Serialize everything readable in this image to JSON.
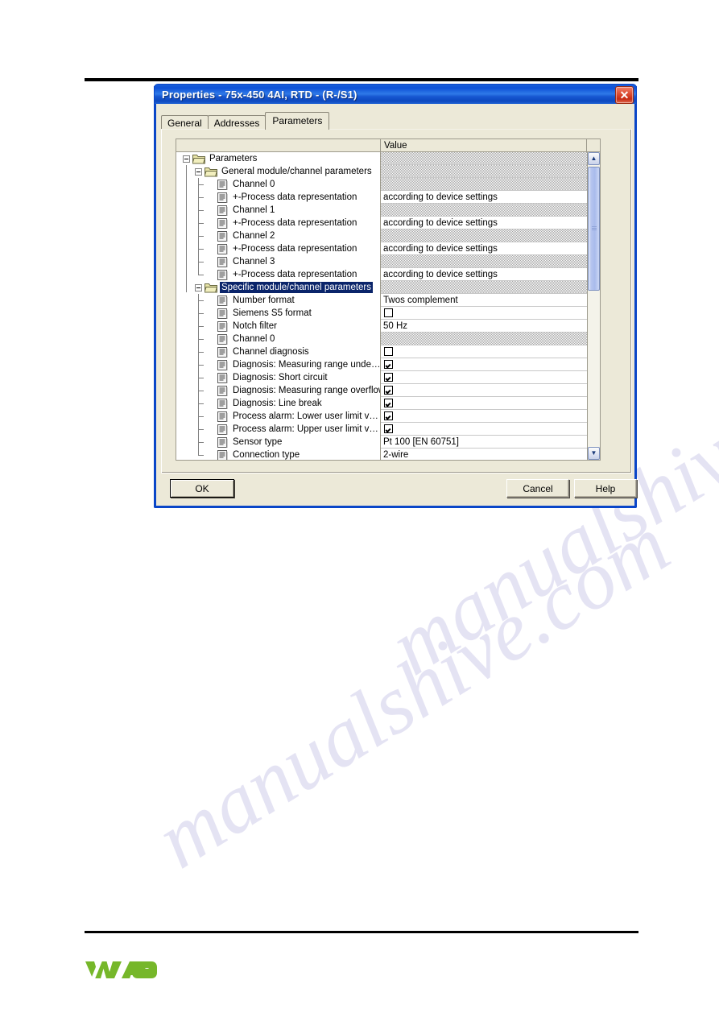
{
  "document": {
    "logo_text": "WAGO"
  },
  "dialog": {
    "title": "Properties - 75x-450 4AI, RTD - (R-/S1)",
    "close_label": "✕",
    "tabs": [
      {
        "label": "General",
        "active": false
      },
      {
        "label": "Addresses",
        "active": false
      },
      {
        "label": "Parameters",
        "active": true
      }
    ],
    "grid": {
      "headers": {
        "name": "",
        "value": "Value"
      },
      "rows": [
        {
          "label": "Parameters",
          "depth": 0,
          "icon": "folder-open-icon",
          "expander": "minus",
          "selected": false,
          "value_type": "disabled",
          "value": ""
        },
        {
          "label": "General module/channel parameters",
          "depth": 1,
          "icon": "folder-open-icon",
          "expander": "minus",
          "selected": false,
          "value_type": "disabled",
          "value": ""
        },
        {
          "label": "Channel 0",
          "depth": 2,
          "icon": "document-icon",
          "expander": "none",
          "selected": false,
          "value_type": "disabled",
          "value": ""
        },
        {
          "label": "+-Process data representation",
          "depth": 2,
          "icon": "document-icon",
          "expander": "none",
          "selected": false,
          "value_type": "text",
          "value": "according to device settings"
        },
        {
          "label": "Channel 1",
          "depth": 2,
          "icon": "document-icon",
          "expander": "none",
          "selected": false,
          "value_type": "disabled",
          "value": ""
        },
        {
          "label": "+-Process data representation",
          "depth": 2,
          "icon": "document-icon",
          "expander": "none",
          "selected": false,
          "value_type": "text",
          "value": "according to device settings"
        },
        {
          "label": "Channel 2",
          "depth": 2,
          "icon": "document-icon",
          "expander": "none",
          "selected": false,
          "value_type": "disabled",
          "value": ""
        },
        {
          "label": "+-Process data representation",
          "depth": 2,
          "icon": "document-icon",
          "expander": "none",
          "selected": false,
          "value_type": "text",
          "value": "according to device settings"
        },
        {
          "label": "Channel 3",
          "depth": 2,
          "icon": "document-icon",
          "expander": "none",
          "selected": false,
          "value_type": "disabled",
          "value": ""
        },
        {
          "label": "+-Process data representation",
          "depth": 2,
          "icon": "document-icon",
          "expander": "none",
          "selected": false,
          "value_type": "text",
          "value": "according to device settings"
        },
        {
          "label": "Specific module/channel parameters",
          "depth": 1,
          "icon": "folder-open-icon",
          "expander": "minus",
          "selected": true,
          "value_type": "disabled",
          "value": ""
        },
        {
          "label": "Number format",
          "depth": 2,
          "icon": "document-icon",
          "expander": "none",
          "selected": false,
          "value_type": "text",
          "value": "Twos complement"
        },
        {
          "label": "Siemens S5 format",
          "depth": 2,
          "icon": "document-icon",
          "expander": "none",
          "selected": false,
          "value_type": "checkbox",
          "value": false
        },
        {
          "label": "Notch filter",
          "depth": 2,
          "icon": "document-icon",
          "expander": "none",
          "selected": false,
          "value_type": "text",
          "value": "50 Hz"
        },
        {
          "label": "Channel 0",
          "depth": 2,
          "icon": "document-icon",
          "expander": "none",
          "selected": false,
          "value_type": "disabled",
          "value": ""
        },
        {
          "label": "Channel diagnosis",
          "depth": 2,
          "icon": "document-icon",
          "expander": "none",
          "selected": false,
          "value_type": "checkbox",
          "value": false
        },
        {
          "label": "Diagnosis: Measuring range unde…",
          "depth": 2,
          "icon": "document-icon",
          "expander": "none",
          "selected": false,
          "value_type": "checkbox",
          "value": true
        },
        {
          "label": "Diagnosis: Short circuit",
          "depth": 2,
          "icon": "document-icon",
          "expander": "none",
          "selected": false,
          "value_type": "checkbox",
          "value": true
        },
        {
          "label": "Diagnosis: Measuring range overflow",
          "depth": 2,
          "icon": "document-icon",
          "expander": "none",
          "selected": false,
          "value_type": "checkbox",
          "value": true
        },
        {
          "label": "Diagnosis: Line break",
          "depth": 2,
          "icon": "document-icon",
          "expander": "none",
          "selected": false,
          "value_type": "checkbox",
          "value": true
        },
        {
          "label": "Process alarm: Lower user limit v…",
          "depth": 2,
          "icon": "document-icon",
          "expander": "none",
          "selected": false,
          "value_type": "checkbox",
          "value": true
        },
        {
          "label": "Process alarm: Upper user limit v…",
          "depth": 2,
          "icon": "document-icon",
          "expander": "none",
          "selected": false,
          "value_type": "checkbox",
          "value": true
        },
        {
          "label": "Sensor type",
          "depth": 2,
          "icon": "document-icon",
          "expander": "none",
          "selected": false,
          "value_type": "text",
          "value": "Pt 100 [EN 60751]"
        },
        {
          "label": "Connection type",
          "depth": 2,
          "icon": "document-icon",
          "expander": "none",
          "selected": false,
          "value_type": "text",
          "value": "2-wire"
        }
      ]
    },
    "scrollbar": {
      "up_arrow": "▲",
      "down_arrow": "▼"
    },
    "buttons": {
      "ok": "OK",
      "cancel": "Cancel",
      "help": "Help"
    }
  },
  "watermark": {
    "line1": "manualshive.com",
    "line2": "manualshive.com"
  }
}
